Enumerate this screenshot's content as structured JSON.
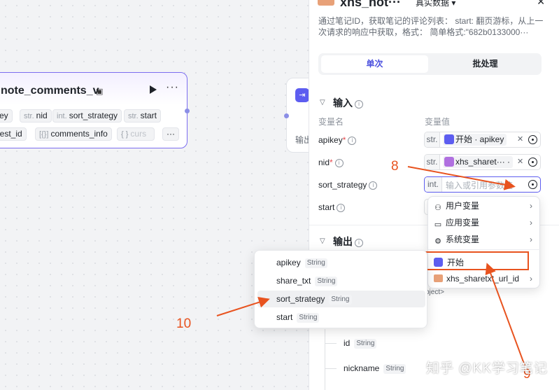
{
  "left_node": {
    "title": "note_comments_v",
    "inputs": [
      {
        "type": "",
        "name": "key"
      },
      {
        "type": "str.",
        "name": "nid"
      },
      {
        "type": "int.",
        "name": "sort_strategy"
      },
      {
        "type": "str.",
        "name": "start"
      }
    ],
    "outputs": [
      {
        "type": "",
        "name": "uest_id"
      },
      {
        "type": "[{}]",
        "name": "comments_info"
      },
      {
        "type": "{ }",
        "name": "curs"
      }
    ],
    "more": "···"
  },
  "mid_node": {
    "label": "输出"
  },
  "panel": {
    "title": "xhs_not···",
    "data_label": "真实数据 ▾",
    "description": "通过笔记ID，获取笔记的评论列表： start: 翻页游标，从上一次请求的响应中获取，格式： 简单格式:\"682b0133000···",
    "tabs": {
      "single": "单次",
      "batch": "批处理"
    },
    "input_section": "输入",
    "col_name": "变量名",
    "col_value": "变量值",
    "vars": [
      {
        "name": "apikey",
        "required": "*",
        "type": "str.",
        "ref": "开始 · apikey"
      },
      {
        "name": "nid",
        "required": "*",
        "type": "str.",
        "ref": "xhs_sharet··· ·"
      },
      {
        "name": "sort_strategy",
        "required": "",
        "type": "int.",
        "placeholder": "输入或引用参数值"
      },
      {
        "name": "start",
        "required": "",
        "type": "",
        "ref": ""
      }
    ],
    "output_section": "输出",
    "object_tag": "bject>",
    "tree": [
      {
        "name": "id",
        "type": "String"
      },
      {
        "name": "nickname",
        "type": "String"
      }
    ]
  },
  "menu": {
    "items": [
      {
        "label": "用户变量",
        "icon": "user-icon"
      },
      {
        "label": "应用变量",
        "icon": "folder-icon"
      },
      {
        "label": "系统变量",
        "icon": "gear-icon"
      },
      {
        "label": "开始",
        "icon": "start-icon"
      },
      {
        "label": "xhs_sharetxt_url_id",
        "icon": "xhs-icon"
      }
    ]
  },
  "popup": {
    "rows": [
      {
        "name": "apikey",
        "type": "String"
      },
      {
        "name": "share_txt",
        "type": "String"
      },
      {
        "name": "sort_strategy",
        "type": "String"
      },
      {
        "name": "start",
        "type": "String"
      }
    ]
  },
  "annotations": {
    "a8": "8",
    "a9": "9",
    "a10": "10"
  },
  "watermark": "知乎 @KK学习笔记",
  "colors": {
    "accent": "#5d5df0",
    "annotation": "#e8531f",
    "node_border": "#7c6df0"
  }
}
